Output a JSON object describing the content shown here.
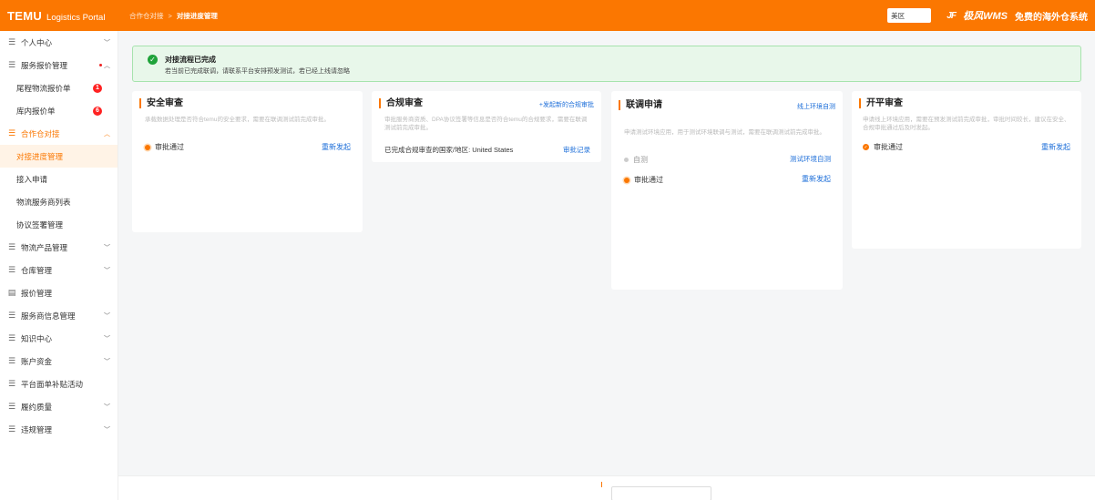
{
  "header": {
    "logo": "TEMU",
    "portal": "Logistics Portal",
    "breadcrumb_parent": "合作仓对接",
    "breadcrumb_sep": ">",
    "breadcrumb_current": "对接进度管理",
    "region": "美区",
    "wms_mark": "JF",
    "wms_name": "极风WMS",
    "wms_slogan": "免费的海外仓系统"
  },
  "sidebar": {
    "items": [
      {
        "label": "个人中心"
      },
      {
        "label": "服务报价管理"
      },
      {
        "label": "尾程物流报价单",
        "badge": "1"
      },
      {
        "label": "库内报价单",
        "badge": "6"
      },
      {
        "label": "合作仓对接"
      },
      {
        "label": "对接进度管理"
      },
      {
        "label": "接入申请"
      },
      {
        "label": "物流服务商列表"
      },
      {
        "label": "协议签署管理"
      },
      {
        "label": "物流产品管理"
      },
      {
        "label": "仓库管理"
      },
      {
        "label": "报价管理"
      },
      {
        "label": "服务商信息管理"
      },
      {
        "label": "知识中心"
      },
      {
        "label": "账户资金"
      },
      {
        "label": "平台面单补贴活动"
      },
      {
        "label": "履约质量"
      },
      {
        "label": "违规管理"
      }
    ]
  },
  "alert": {
    "title": "对接流程已完成",
    "text": "若当前已完成联调，请联系平台安排预发测试，若已经上线请忽略"
  },
  "cards": {
    "security": {
      "title": "安全审查",
      "desc": "承载数据处理是否符合temu的安全要求，需要在联调测试前完成审批。",
      "status": "审批通过",
      "action": "重新发起"
    },
    "compliance": {
      "title": "合规审查",
      "link": "+发起新的合规审批",
      "desc": "审批服务商资质、DPA协议签署等信息是否符合temu的合规要求，需要在联调测试前完成审批。",
      "region_text": "已完成合规审查的国家/地区: United States",
      "action": "审批记录"
    },
    "integration": {
      "title": "联调申请",
      "link": "线上环境自测",
      "desc": "申请测试环境应用，用于测试环境联调与测试，需要在联调测试前完成审批。",
      "self_test": "自测",
      "self_test_action": "测试环境自测",
      "status": "审批通过",
      "action": "重新发起"
    },
    "golive": {
      "title": "开平审查",
      "desc": "申请线上环境应用，需要在预发测试前完成审批，审批时间较长，建议在安全、合规审批通过后及时发起。",
      "status": "审批通过",
      "action": "重新发起"
    }
  }
}
